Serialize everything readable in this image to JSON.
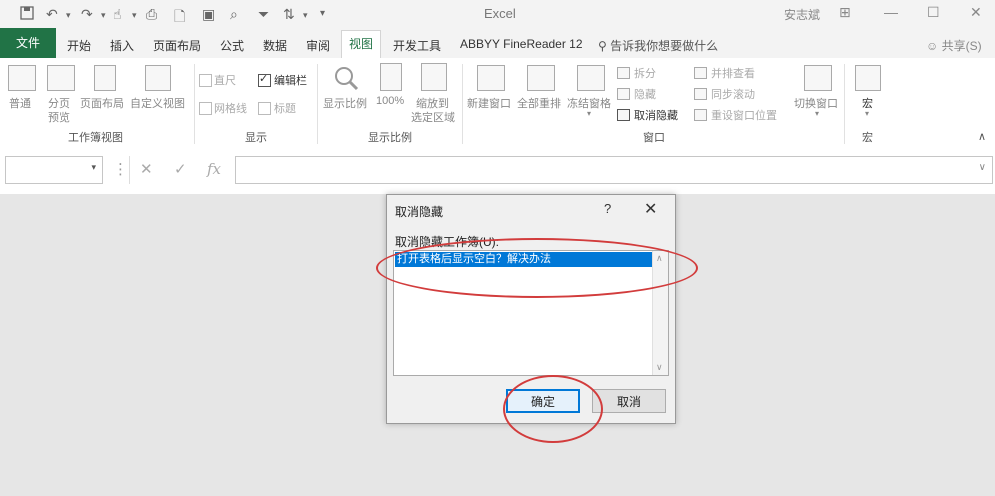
{
  "app": {
    "title": "Excel",
    "user": "安志斌"
  },
  "window_controls": [
    "⊞",
    "—",
    "☐",
    "✕"
  ],
  "quick_access": [
    "save-icon",
    "undo-icon",
    "redo-icon",
    "touch-mode-icon",
    "camera-icon",
    "print-preview-icon",
    "open-icon",
    "zoom-icon",
    "filter-icon",
    "sort-icon",
    "customize-icon"
  ],
  "tabs": {
    "file": "文件",
    "items": [
      "开始",
      "插入",
      "页面布局",
      "公式",
      "数据",
      "审阅",
      "视图",
      "开发工具",
      "ABBYY FineReader 12"
    ],
    "active": "视图",
    "tell_me": "告诉我你想要做什么",
    "share": "共享(S)"
  },
  "ribbon": {
    "workbook_views": {
      "group": "工作簿视图",
      "normal": "普通",
      "page_break_1": "分页",
      "page_break_2": "预览",
      "page_layout": "页面布局",
      "custom_views": "自定义视图"
    },
    "show": {
      "group": "显示",
      "ruler": "直尺",
      "formula_bar": "编辑栏",
      "gridlines": "网格线",
      "headings": "标题"
    },
    "zoom": {
      "group": "显示比例",
      "zoom": "显示比例",
      "pct100": "100%",
      "zoom_sel_1": "缩放到",
      "zoom_sel_2": "选定区域"
    },
    "window": {
      "group": "窗口",
      "new_window": "新建窗口",
      "arrange_all": "全部重排",
      "freeze": "冻结窗格",
      "split": "拆分",
      "hide": "隐藏",
      "unhide": "取消隐藏",
      "side_by_side": "并排查看",
      "sync_scroll": "同步滚动",
      "reset_position": "重设窗口位置",
      "switch": "切换窗口"
    },
    "macros": {
      "group": "宏",
      "macros": "宏"
    }
  },
  "formula_bar": {
    "fx": "fx",
    "cancel": "✕",
    "enter": "✓",
    "more": "⋮"
  },
  "dialog": {
    "title": "取消隐藏",
    "help": "?",
    "close": "✕",
    "label": "取消隐藏工作簿(U):",
    "items": [
      "打开表格后显示空白？解决办法"
    ],
    "ok": "确定",
    "cancel": "取消"
  },
  "colors": {
    "accent": "#217346",
    "selection": "#0078d7",
    "annotation": "#d23c3c"
  }
}
